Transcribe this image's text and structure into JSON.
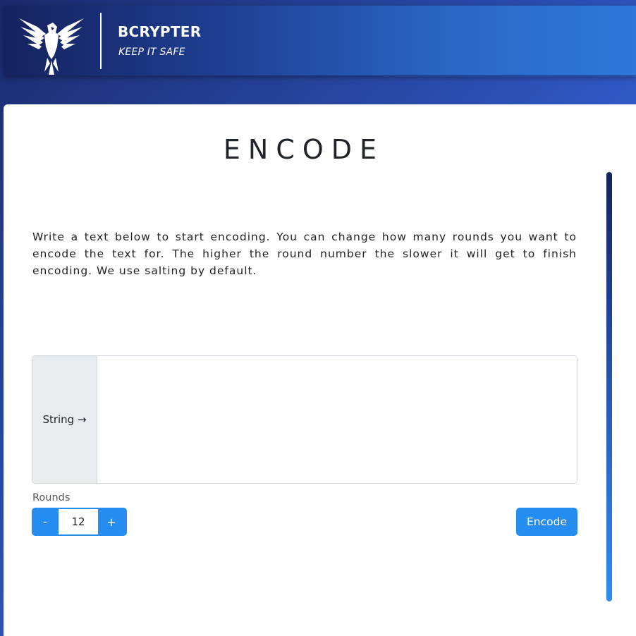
{
  "header": {
    "brand": "BCRYPTER",
    "tagline": "KEEP IT SAFE",
    "logo_icon": "eagle-logo-icon"
  },
  "main": {
    "title": "ENCODE",
    "description": "Write a text below to start encoding. You can change how many rounds you want to encode the text for. The higher the round number the slower it will get to finish encoding. We use salting by default.",
    "input": {
      "prefix_label": "String →",
      "value": "",
      "placeholder": ""
    },
    "rounds": {
      "label": "Rounds",
      "decrement_label": "-",
      "value": "12",
      "increment_label": "+"
    },
    "encode_label": "Encode"
  },
  "colors": {
    "accent": "#268df0",
    "header_dark": "#15225e",
    "header_light": "#2f78d8"
  }
}
